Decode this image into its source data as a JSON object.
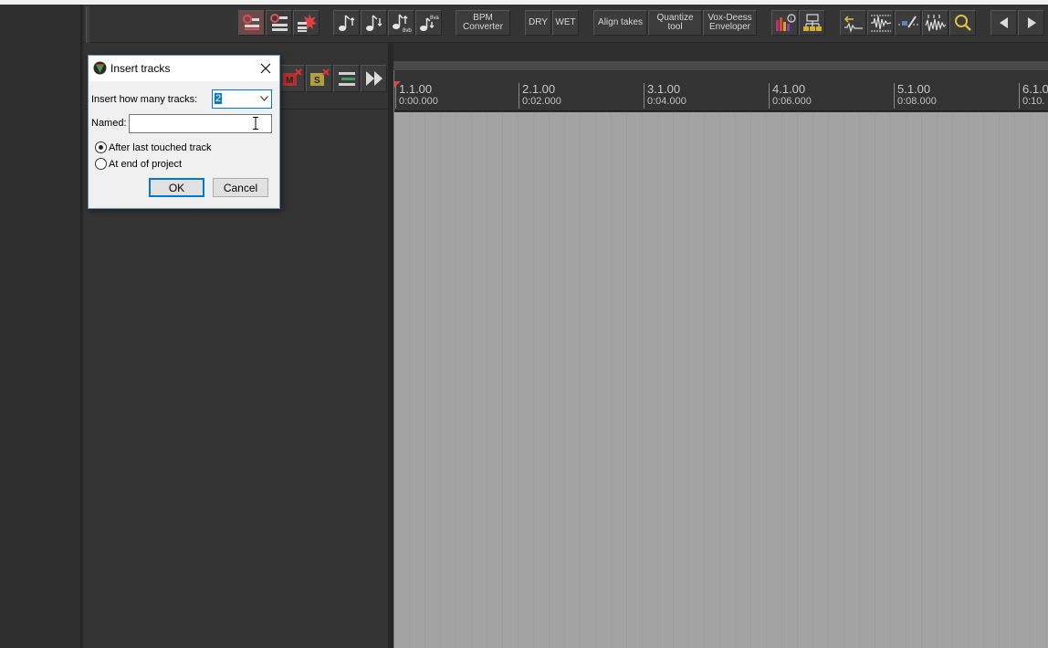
{
  "toolbar": {
    "bpm_converter": "BPM\nConverter",
    "dry": "DRY",
    "wet": "WET",
    "align_takes": "Align takes",
    "quantize_tool": "Quantize\ntool",
    "vox_deess": "Vox-Deess\nEnveloper",
    "pitch_8va": "8va",
    "pitch_8vb": "8vb"
  },
  "ruler": {
    "marks": [
      {
        "beat": "1.1.00",
        "time": "0:00.000"
      },
      {
        "beat": "2.1.00",
        "time": "0:02.000"
      },
      {
        "beat": "3.1.00",
        "time": "0:04.000"
      },
      {
        "beat": "4.1.00",
        "time": "0:06.000"
      },
      {
        "beat": "5.1.00",
        "time": "0:08.000"
      },
      {
        "beat": "6.1.0",
        "time": "0:10."
      }
    ]
  },
  "tcp_toolbar": {
    "mute_letter": "M",
    "solo_letter": "S"
  },
  "dialog": {
    "title": "Insert tracks",
    "count_label": "Insert how many tracks:",
    "count_value": "2",
    "name_label": "Named:",
    "name_value": "",
    "option_after": "After last touched track",
    "option_end": "At end of project",
    "ok_label": "OK",
    "cancel_label": "Cancel"
  },
  "colors": {
    "accent": "#0078d7",
    "arrange_bg": "#a3a3a3",
    "panel_bg": "#333333"
  }
}
